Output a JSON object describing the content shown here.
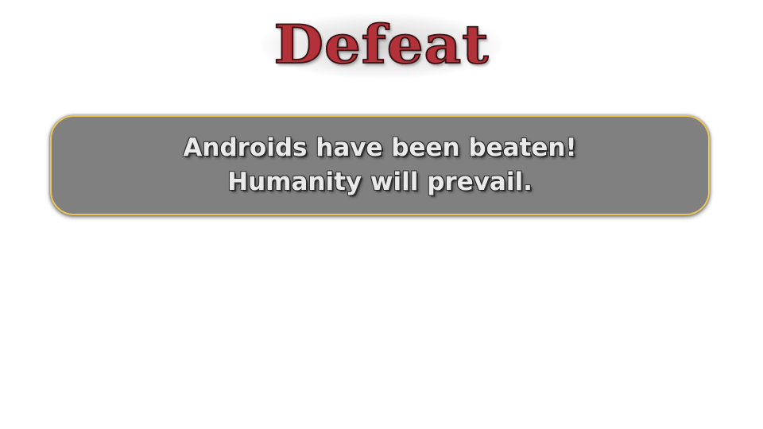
{
  "screen": {
    "title": "Defeat",
    "message": {
      "line1": "Androids have been beaten!",
      "line2": "Humanity will prevail."
    }
  },
  "colors": {
    "title_fill": "#b3323a",
    "title_outline": "#3a1214",
    "box_fill": "#808080",
    "box_border": "#e8c45a",
    "message_text": "#eaeaea"
  }
}
